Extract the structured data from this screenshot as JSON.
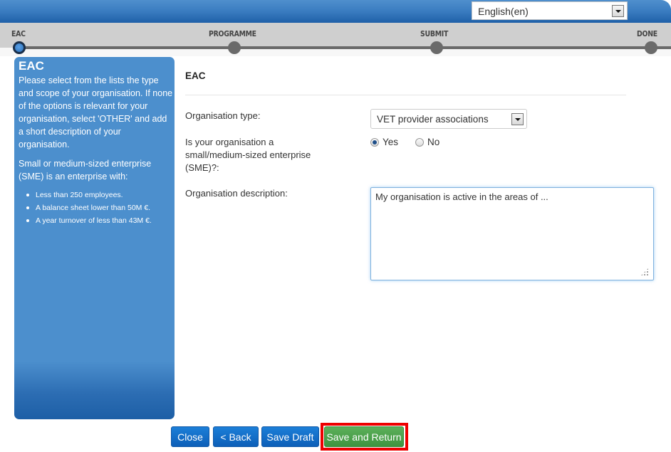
{
  "header": {
    "language_select": {
      "value": "English(en)"
    }
  },
  "steps": [
    {
      "label": "EAC",
      "active": true
    },
    {
      "label": "PROGRAMME",
      "active": false
    },
    {
      "label": "SUBMIT",
      "active": false
    },
    {
      "label": "DONE",
      "active": false
    }
  ],
  "sidebar": {
    "title": "EAC",
    "intro": "Please select from the lists the type and scope of your organisation. If none of the options is relevant for your organisation, select 'OTHER' and add a short description of your organisation.",
    "sme_text": "Small or medium-sized enterprise (SME) is an enterprise with:",
    "criteria": [
      "Less than 250 employees.",
      "A balance sheet lower than 50M €.",
      "A year turnover of less than 43M €."
    ]
  },
  "form": {
    "title": "EAC",
    "org_type": {
      "label": "Organisation type:",
      "value": "VET provider associations"
    },
    "sme": {
      "label": "Is your organisation a small/medium-sized enterprise (SME)?:",
      "options": [
        {
          "label": "Yes",
          "checked": true
        },
        {
          "label": "No",
          "checked": false
        }
      ]
    },
    "description": {
      "label": "Organisation description:",
      "value": "My organisation is active in the areas of ..."
    }
  },
  "buttons": {
    "close": "Close",
    "back": "< Back",
    "save_draft": "Save Draft",
    "save_and_return": "Save and Return"
  },
  "colors": {
    "header_blue": "#3a7cc0",
    "sidebar_blue": "#4c8fcd",
    "button_blue": "#1c7fd8",
    "button_green": "#4fa34e",
    "highlight_red": "#ee0000"
  }
}
